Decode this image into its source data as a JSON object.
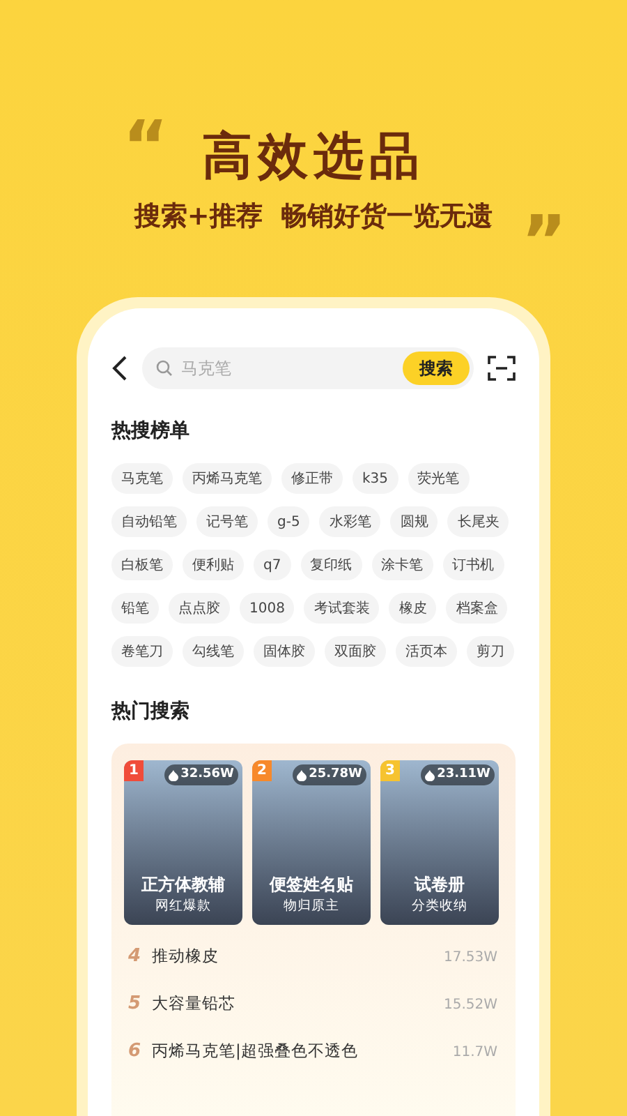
{
  "banner": {
    "quote_open": "“",
    "title": "高效选品",
    "subtitle": "搜索+推荐  畅销好货一览无遗",
    "quote_close": "”"
  },
  "search": {
    "placeholder": "马克笔",
    "button": "搜索"
  },
  "hot_list": {
    "title": "热搜榜单",
    "tags": [
      "马克笔",
      "丙烯马克笔",
      "修正带",
      "k35",
      "荧光笔",
      "自动铅笔",
      "记号笔",
      "g-5",
      "水彩笔",
      "圆规",
      "长尾夹",
      "白板笔",
      "便利贴",
      "q7",
      "复印纸",
      "涂卡笔",
      "订书机",
      "铅笔",
      "点点胶",
      "1008",
      "考试套装",
      "橡皮",
      "档案盒",
      "卷笔刀",
      "勾线笔",
      "固体胶",
      "双面胶",
      "活页本",
      "剪刀"
    ]
  },
  "hot_search": {
    "title": "热门搜索",
    "top": [
      {
        "rank": "1",
        "color": "#f04c3a",
        "heat": "32.56W",
        "name": "正方体教辅",
        "tagline": "网红爆款"
      },
      {
        "rank": "2",
        "color": "#f7892b",
        "heat": "25.78W",
        "name": "便签姓名贴",
        "tagline": "物归原主"
      },
      {
        "rank": "3",
        "color": "#f6c330",
        "heat": "23.11W",
        "name": "试卷册",
        "tagline": "分类收纳"
      }
    ],
    "rows": [
      {
        "rank": "4",
        "name": "推动橡皮",
        "heat": "17.53W"
      },
      {
        "rank": "5",
        "name": "大容量铅芯",
        "heat": "15.52W"
      },
      {
        "rank": "6",
        "name": "丙烯马克笔|超强叠色不透色",
        "heat": "11.7W"
      }
    ]
  }
}
